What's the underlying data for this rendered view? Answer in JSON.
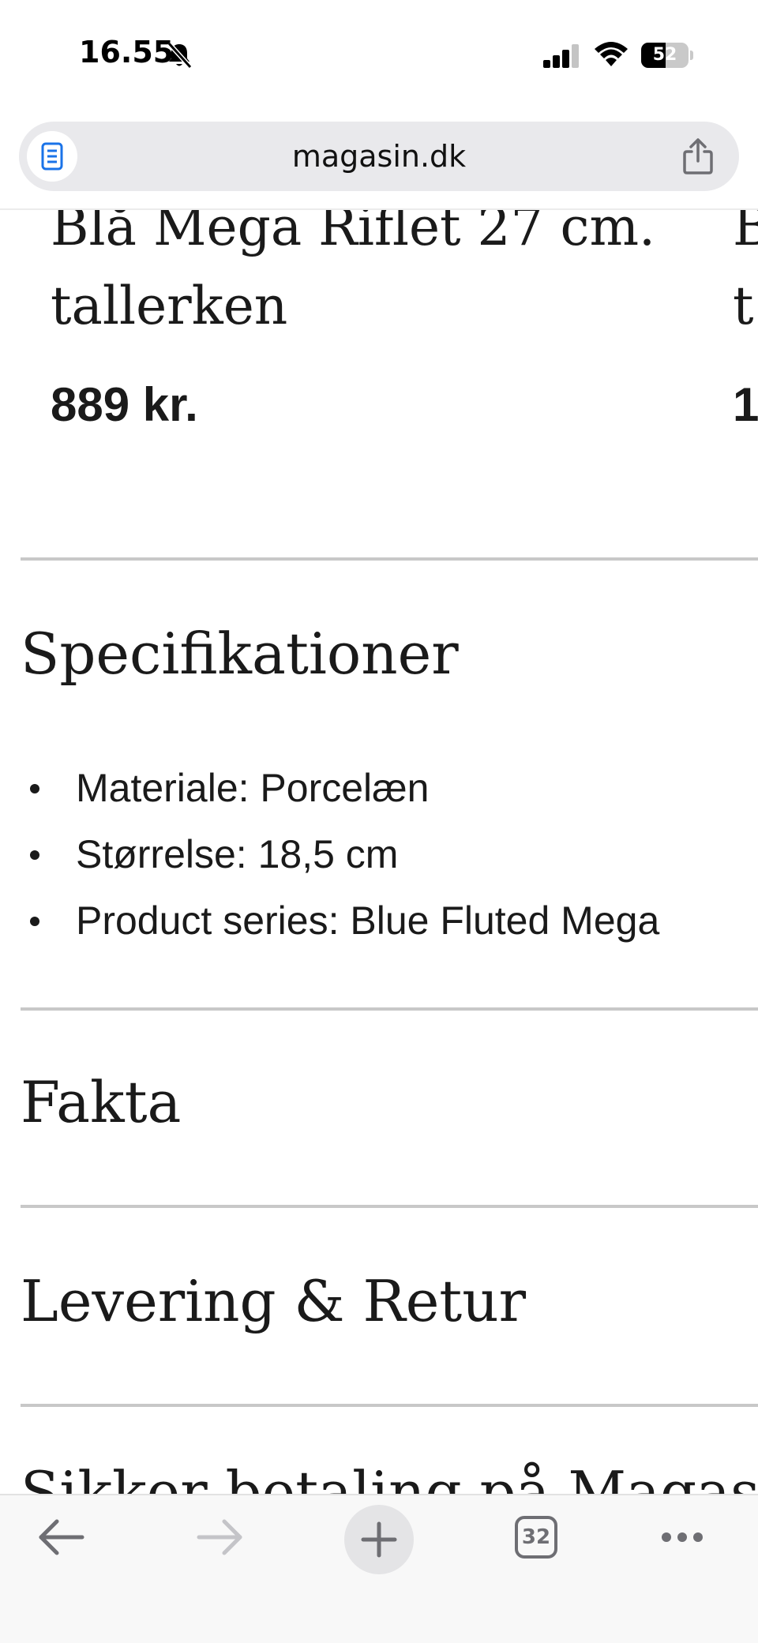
{
  "status_bar": {
    "time": "16.55",
    "battery_level": "52",
    "battery_fraction": 0.52
  },
  "browser": {
    "url": "magasin.dk",
    "tab_count": "32"
  },
  "products": [
    {
      "title_line_1": "Blå Mega Riflet 27 cm.",
      "title_line_2": "tallerken",
      "price": "889 kr."
    },
    {
      "title_line_1": "B",
      "title_line_2": "t",
      "price": "1"
    }
  ],
  "sections": {
    "specifications": {
      "heading": "Specifikationer",
      "items": [
        "Materiale: Porcelæn",
        "Størrelse: 18,5 cm",
        "Product series: Blue Fluted Mega"
      ]
    },
    "facts": {
      "heading": "Fakta"
    },
    "delivery": {
      "heading": "Levering & Retur"
    },
    "safe_shopping": {
      "heading": "Sikker betaling på Magasin"
    }
  },
  "icons": {
    "mute": "bell-slash-icon",
    "signal": "cellular-signal-icon",
    "wifi": "wifi-icon",
    "reader": "reader-mode-icon",
    "share": "share-icon",
    "back": "arrow-left-icon",
    "forward": "arrow-right-icon",
    "new_tab": "plus-icon",
    "more": "ellipsis-icon"
  },
  "colors": {
    "text": "#1a1a1a",
    "divider": "#c8c8c8",
    "url_bar": "#e9e9ec",
    "reader_icon": "#1a73e8",
    "toolbar_icon": "#6e6e73",
    "toolbar_icon_disabled": "#c4c4c8"
  }
}
